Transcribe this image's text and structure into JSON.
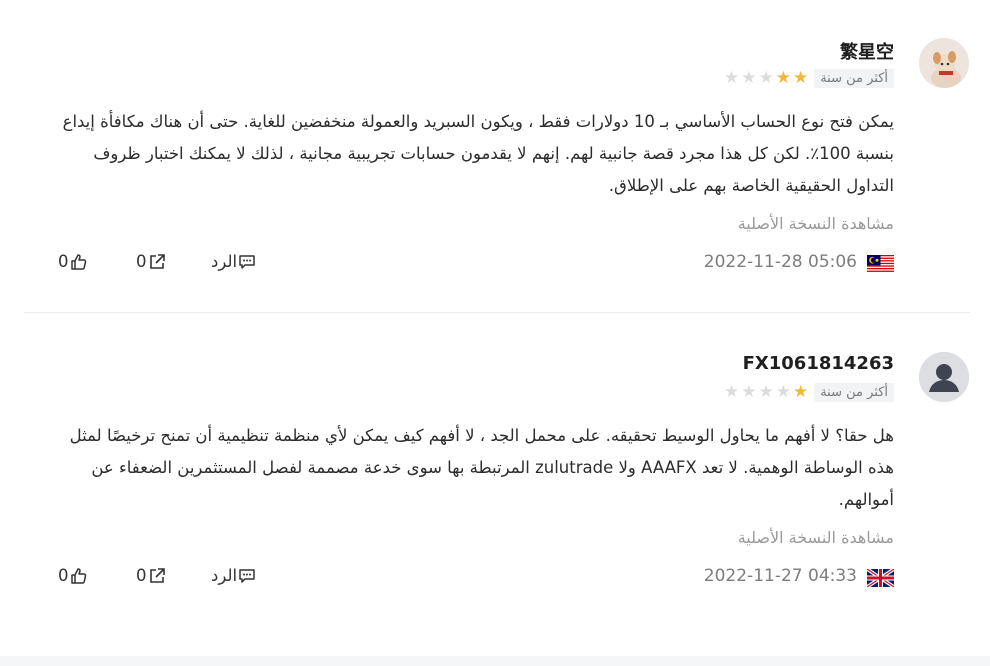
{
  "reviews": [
    {
      "username": "繁星空",
      "rating": 2,
      "time_ago": "أكثر من سنة",
      "text_lines": [
        "يمكن فتح نوع الحساب الأساسي بـ 10 دولارات فقط ، ويكون السبريد والعمولة منخفضين للغاية. حتى أن هناك مكافأة إيداع",
        "بنسبة 100٪. لكن كل هذا مجرد قصة جانبية لهم. إنهم لا يقدمون حسابات تجريبية مجانية ، لذلك لا يمكنك اختبار ظروف",
        "التداول الحقيقية الخاصة بهم على الإطلاق."
      ],
      "original_label": "مشاهدة النسخة الأصلية",
      "datetime": "2022-11-28 05:06",
      "flag": "malaysia-flag",
      "reply_label": "الرد",
      "share_count": "0",
      "like_count": "0"
    },
    {
      "username": "FX1061814263",
      "rating": 1,
      "time_ago": "أكثر من سنة",
      "text_lines": [
        "هل حقا؟ لا أفهم ما يحاول الوسيط تحقيقه. على محمل الجد ، لا أفهم كيف يمكن لأي منظمة تنظيمية أن تمنح ترخيصًا لمثل",
        "هذه الوساطة الوهمية. لا تعد AAAFX ولا zulutrade المرتبطة بها سوى خدعة مصممة لفصل المستثمرين الضعفاء عن",
        "أموالهم."
      ],
      "original_label": "مشاهدة النسخة الأصلية",
      "datetime": "2022-11-27 04:33",
      "flag": "uk-flag",
      "reply_label": "الرد",
      "share_count": "0",
      "like_count": "0"
    }
  ],
  "colors": {
    "star_on": "#f4b73a",
    "star_off": "#dcdcdc",
    "muted_text": "#999999"
  }
}
